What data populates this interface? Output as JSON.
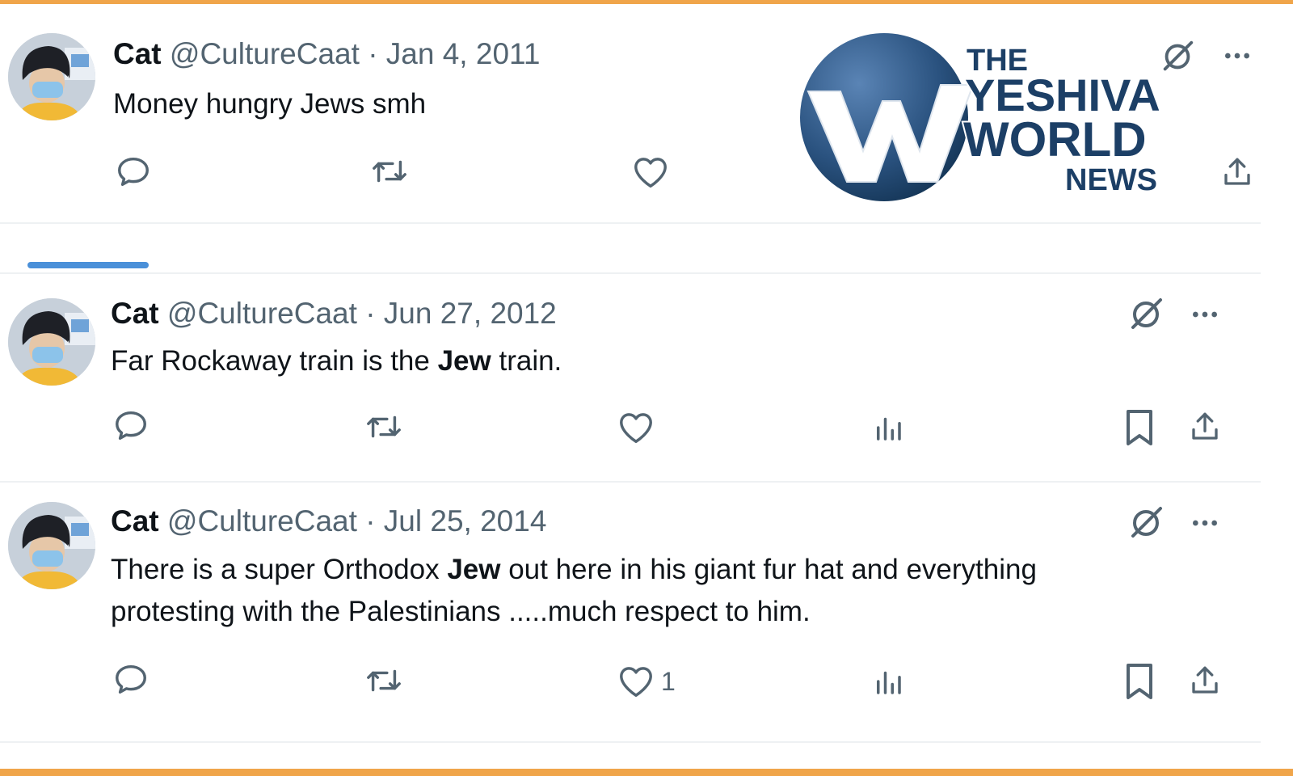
{
  "brand": {
    "logo_line1": "THE",
    "logo_line2": "YESHIVA",
    "logo_line3": "WORLD",
    "logo_line4": "NEWS",
    "frame_color": "#f0a54a",
    "logo_blue": "#1c3f66"
  },
  "tweets": [
    {
      "name": "Cat",
      "handle": "@CultureCaat",
      "sep": "·",
      "date": "Jan 4, 2011",
      "text_parts": [
        "Money hungry Jews smh"
      ],
      "actions": [
        "reply-icon",
        "retweet-icon",
        "like-icon",
        "share-icon"
      ]
    },
    {
      "name": "Cat",
      "handle": "@CultureCaat",
      "sep": "·",
      "date": "Jun 27, 2012",
      "text_parts": [
        "Far Rockaway train is the ",
        "Jew",
        " train."
      ],
      "actions": [
        "reply-icon",
        "retweet-icon",
        "like-icon",
        "views-icon",
        "bookmark-icon",
        "share-icon"
      ]
    },
    {
      "name": "Cat",
      "handle": "@CultureCaat",
      "sep": "·",
      "date": "Jul 25, 2014",
      "text_parts": [
        "There is a super Orthodox ",
        "Jew",
        " out here in his giant fur hat and everything",
        "protesting with the Palestinians .....much respect to him."
      ],
      "like_count": "1",
      "actions": [
        "reply-icon",
        "retweet-icon",
        "like-icon",
        "views-icon",
        "bookmark-icon",
        "share-icon"
      ]
    }
  ],
  "menu_glyph": "···"
}
